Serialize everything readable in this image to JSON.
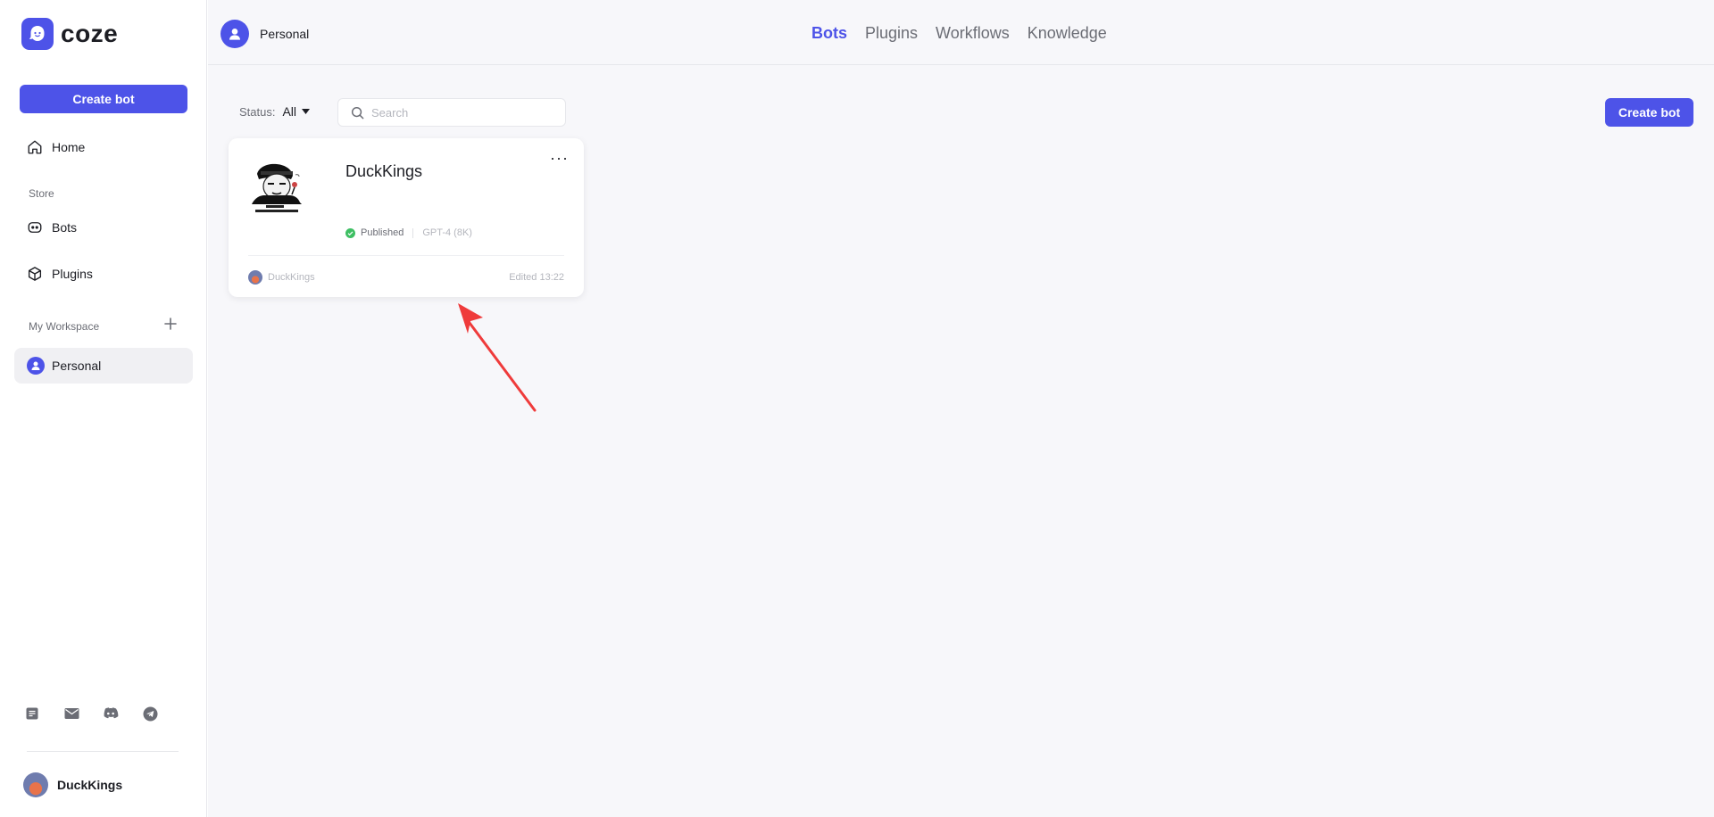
{
  "brand": {
    "name": "coze",
    "accent": "#4d53e8"
  },
  "sidebar": {
    "create_label": "Create bot",
    "home_label": "Home",
    "store_label": "Store",
    "bots_label": "Bots",
    "plugins_label": "Plugins",
    "workspace_label": "My Workspace",
    "personal_label": "Personal",
    "bottom_icons": [
      "doc-icon",
      "mail-icon",
      "discord-icon",
      "telegram-icon"
    ],
    "user_name": "DuckKings"
  },
  "topbar": {
    "space_name": "Personal",
    "tabs": [
      {
        "label": "Bots",
        "active": true
      },
      {
        "label": "Plugins",
        "active": false
      },
      {
        "label": "Workflows",
        "active": false
      },
      {
        "label": "Knowledge",
        "active": false
      }
    ]
  },
  "toolbar": {
    "status_label": "Status:",
    "status_value": "All",
    "search_placeholder": "Search",
    "create_label": "Create bot"
  },
  "bot_card": {
    "name": "DuckKings",
    "status": "Published",
    "model": "GPT-4 (8K)",
    "owner": "DuckKings",
    "edited": "Edited 13:22",
    "status_color": "#3ebf63"
  },
  "annotation": {
    "arrow_color": "#ef3b3b"
  }
}
